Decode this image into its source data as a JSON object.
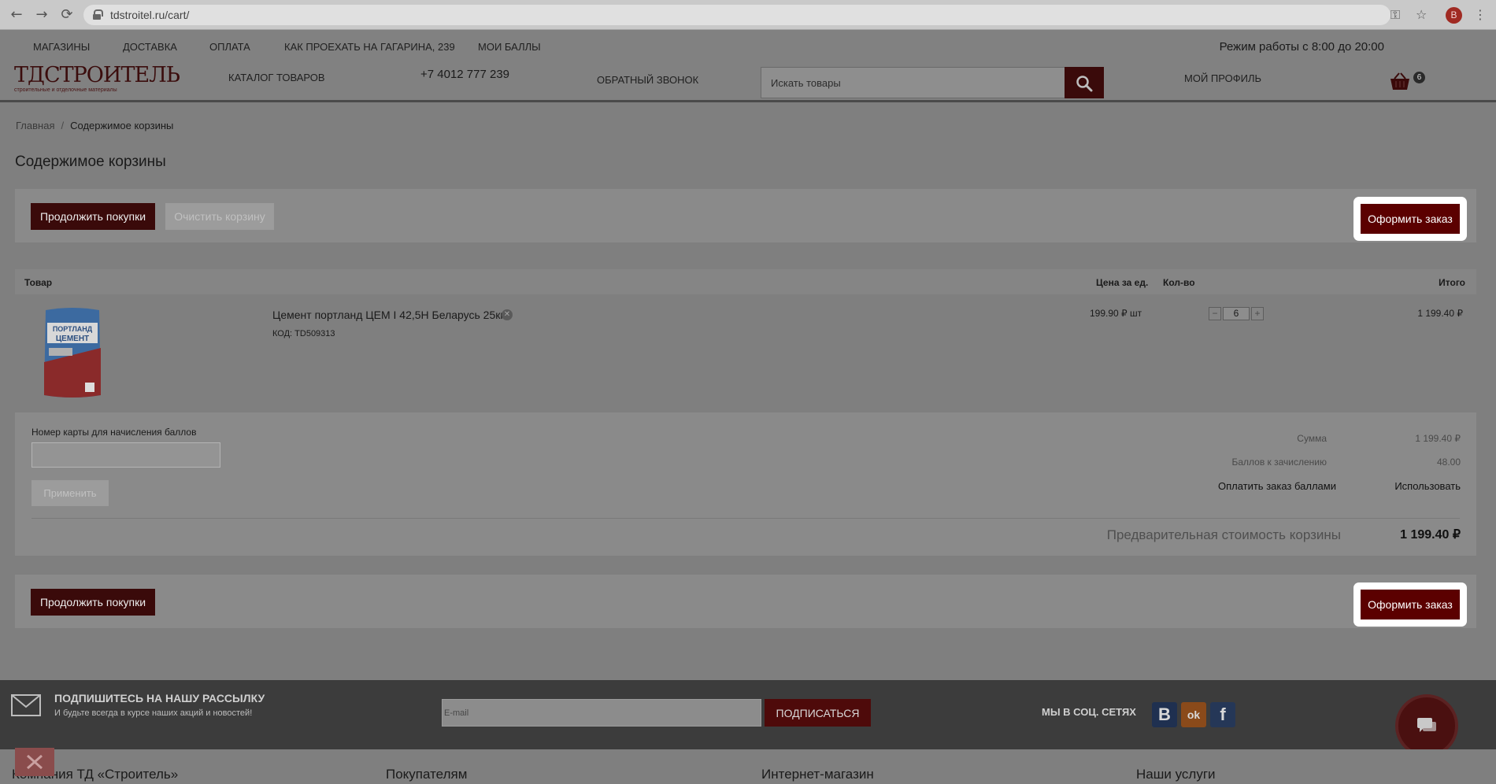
{
  "browser": {
    "url": "tdstroitel.ru/cart/",
    "avatar_letter": "B"
  },
  "header": {
    "top_nav": [
      "Магазины",
      "Доставка",
      "Оплата",
      "Как проехать на Гагарина, 239",
      "Мои баллы"
    ],
    "work_hours": "Режим работы с 8:00 до 20:00",
    "logo_main": "ТДСТРОИТЕЛЬ",
    "logo_sub": "строительные и отделочные материалы",
    "catalog": "Каталог товаров",
    "phone": "+7 4012 777 239",
    "callback": "Обратный звонок",
    "search_placeholder": "Искать товары",
    "profile": "Мой профиль",
    "cart_count": "6"
  },
  "breadcrumb": {
    "home": "Главная",
    "separator": "/",
    "current": "Содержимое корзины"
  },
  "page_title": "Содержимое корзины",
  "actions": {
    "continue": "Продолжить покупки",
    "clear": "Очистить корзину",
    "checkout": "Оформить заказ"
  },
  "table": {
    "col_product": "Товар",
    "col_price": "Цена за ед.",
    "col_qty": "Кол-во",
    "col_total": "Итого"
  },
  "item": {
    "name": "Цемент портланд ЦЕМ I 42,5Н Беларусь 25кг",
    "code": "КОД: TD509313",
    "price": "199.90 ₽  шт",
    "qty": "6",
    "total": "1 199.40  ₽",
    "image_text": "ПОРТЛАНД ЦЕМЕНТ"
  },
  "summary": {
    "card_label": "Номер карты для начисления баллов",
    "apply": "Применить",
    "sum_label": "Сумма",
    "sum_value": "1 199.40 ₽",
    "points_label": "Баллов к зачислению",
    "points_value": "48.00",
    "pay_points_label": "Оплатить заказ баллами",
    "pay_points_action": "Использовать",
    "prelim_label": "Предварительная стоимость корзины",
    "prelim_value": "1 199.40 ₽"
  },
  "newsletter": {
    "title": "Подпишитесь на нашу рассылку",
    "subtitle": "И будьте всегда в курсе наших акций и новостей!",
    "email_placeholder": "E-mail",
    "subscribe": "Подписаться",
    "social_label": "Мы в соц. сетях",
    "social": [
      {
        "label": "В",
        "color": "#1f3050"
      },
      {
        "label": "ok",
        "color": "#8a4a1a"
      },
      {
        "label": "f",
        "color": "#253757"
      }
    ]
  },
  "footer": {
    "columns": [
      "Компания ТД «Строитель»",
      "Покупателям",
      "Интернет-магазин",
      "Наши услуги"
    ]
  }
}
